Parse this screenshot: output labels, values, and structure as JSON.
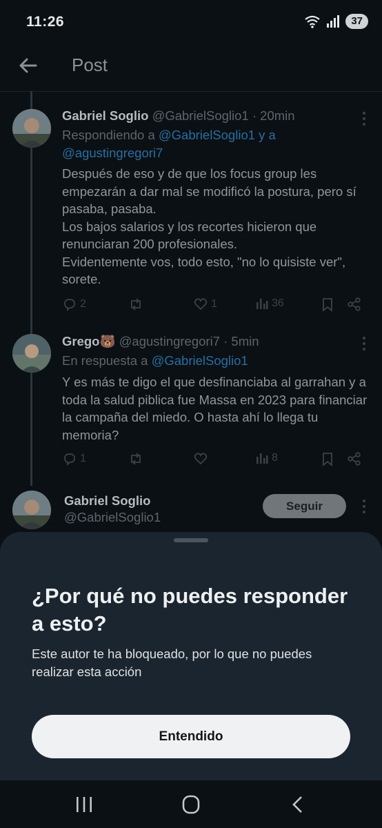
{
  "status": {
    "time": "11:26",
    "battery": "37"
  },
  "header": {
    "title": "Post"
  },
  "tweets": [
    {
      "name": "Gabriel Soglio",
      "handle": "@GabrielSoglio1",
      "sep": "·",
      "time": "20min",
      "reply_prefix": "Respondiendo a",
      "reply_to": "@GabrielSoglio1 y a @agustingregori7",
      "body": "Después de eso y de que los focus group les empezarán a dar mal se modificó la postura, pero sí pasaba, pasaba.\nLos bajos salarios y los recortes hicieron que renunciaran 200 profesionales.\nEvidentemente vos, todo esto, \"no lo quisiste ver\", sorete.",
      "replies": "2",
      "retweets": "",
      "likes": "1",
      "views": "36"
    },
    {
      "name": "Grego🐻",
      "handle": "@agustingregori7",
      "sep": "·",
      "time": "5min",
      "reply_prefix": "En respuesta a",
      "reply_to": "@GabrielSoglio1",
      "body": "Y es más te digo el que desfinanciaba al garrahan y a toda la salud piblica fue Massa en 2023 para financiar la campaña del miedo. O hasta ahí lo llega tu memoria?",
      "replies": "1",
      "retweets": "",
      "likes": "",
      "views": "8"
    }
  ],
  "follow_card": {
    "name": "Gabriel Soglio",
    "handle": "@GabrielSoglio1",
    "button": "Seguir"
  },
  "sheet": {
    "title": "¿Por qué no puedes responder a esto?",
    "description": "Este autor te ha bloqueado, por lo que no puedes realizar esta acción",
    "button": "Entendido"
  },
  "icons": {
    "back": "arrow-left-icon",
    "more": "more-vertical-icon",
    "reply": "reply-icon",
    "retweet": "retweet-icon",
    "like": "heart-icon",
    "views": "views-icon",
    "bookmark": "bookmark-icon",
    "share": "share-icon",
    "recents": "recents-icon",
    "home": "home-icon",
    "nav_back": "nav-back-icon"
  },
  "colors": {
    "background": "#0b1014",
    "sheet": "#1b252f",
    "link": "#1d9bf0",
    "button": "#eff1f2"
  }
}
